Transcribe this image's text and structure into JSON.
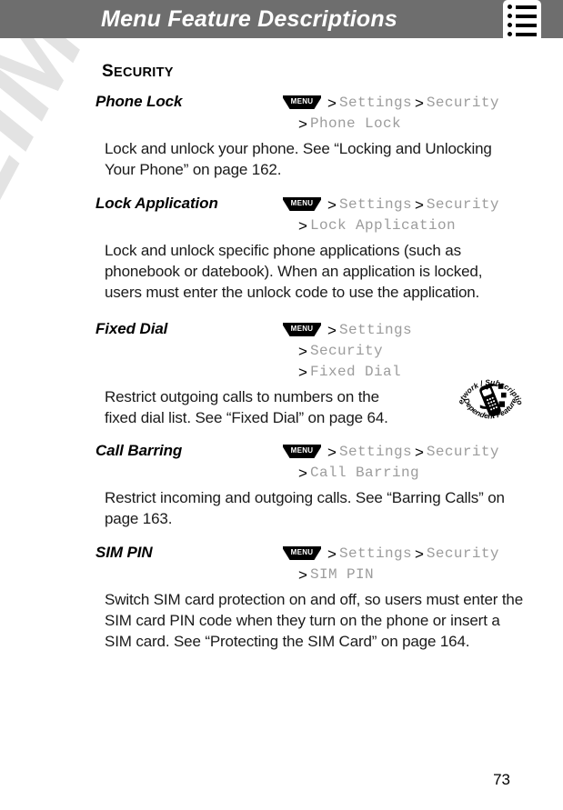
{
  "header": {
    "title": "Menu Feature Descriptions",
    "icon": "list-icon",
    "bar_color": "#6e6e6e",
    "title_color": "#ffffff"
  },
  "watermark": {
    "text": "PRELIMINARY",
    "color": "#e3e3e3"
  },
  "section": {
    "heading_first_letter": "S",
    "heading_rest": "ECURITY",
    "heading_full": "SECURITY"
  },
  "menu_badge_label": "MENU",
  "separator": ">",
  "path_color": "#9c9c9c",
  "entries": [
    {
      "term": "Phone Lock",
      "path_lines": [
        {
          "badge": true,
          "items": [
            "Settings",
            "Security"
          ]
        },
        {
          "badge": false,
          "items": [
            "Phone Lock"
          ]
        }
      ],
      "description": "Lock and unlock your phone. See “Locking and Unlocking Your Phone” on page 162."
    },
    {
      "term": "Lock Application",
      "path_lines": [
        {
          "badge": true,
          "items": [
            "Settings",
            "Security"
          ]
        },
        {
          "badge": false,
          "items": [
            "Lock Application"
          ]
        }
      ],
      "description": "Lock and unlock specific phone applications (such as phonebook or datebook). When an application is locked, users must enter the unlock code to use the application."
    },
    {
      "term": "Fixed Dial",
      "path_lines": [
        {
          "badge": true,
          "items": [
            "Settings"
          ]
        },
        {
          "badge": false,
          "items": [
            "Security"
          ]
        },
        {
          "badge": false,
          "items": [
            "Fixed Dial"
          ]
        }
      ],
      "description": "Restrict outgoing calls to numbers on the fixed dial list. See “Fixed Dial” on page 64.",
      "badge_icon": {
        "name": "network-subscription-dependent-feature-icon",
        "top_text": "Network / Subscription",
        "bottom_text": "Dependent Feature"
      }
    },
    {
      "term": "Call Barring",
      "path_lines": [
        {
          "badge": true,
          "items": [
            "Settings",
            "Security"
          ]
        },
        {
          "badge": false,
          "items": [
            "Call Barring"
          ]
        }
      ],
      "description": "Restrict incoming and outgoing calls. See “Barring Calls” on page 163."
    },
    {
      "term": "SIM PIN",
      "path_lines": [
        {
          "badge": true,
          "items": [
            "Settings",
            "Security"
          ]
        },
        {
          "badge": false,
          "items": [
            "SIM PIN"
          ]
        }
      ],
      "description": "Switch SIM card protection on and off, so users must enter the SIM card PIN code when they turn on the phone or insert a SIM card. See “Protecting the SIM Card” on page 164."
    }
  ],
  "page_number": "73"
}
